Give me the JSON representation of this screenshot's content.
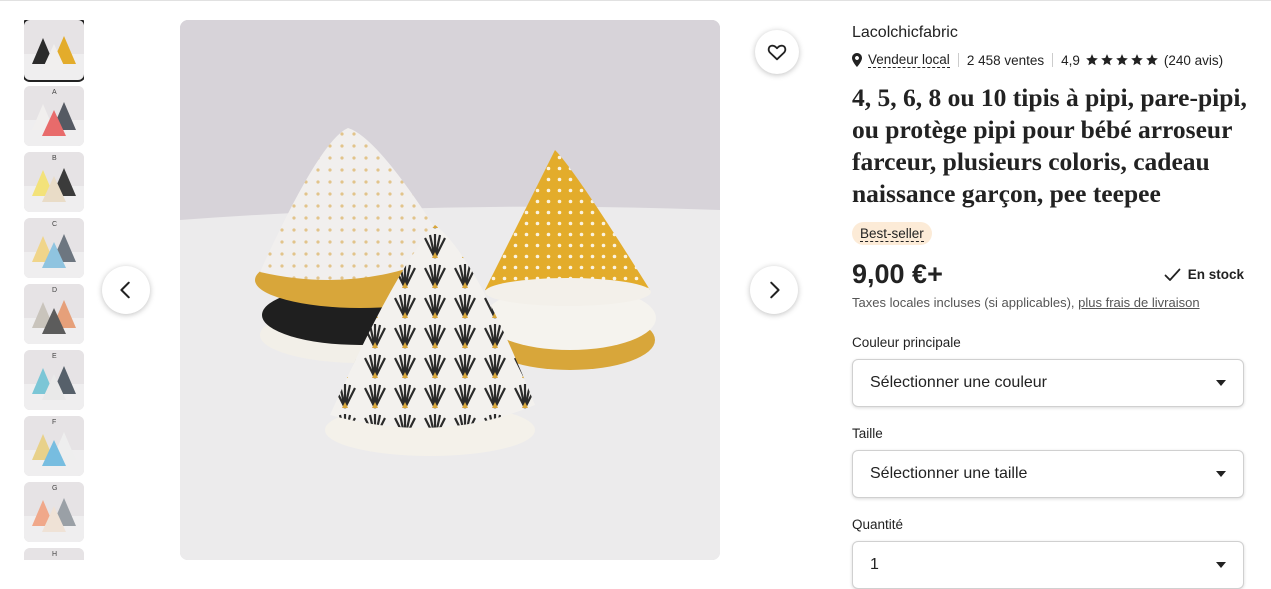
{
  "gallery": {
    "thumbnails": [
      {
        "label": "",
        "selected": true
      },
      {
        "label": "A",
        "selected": false
      },
      {
        "label": "B",
        "selected": false
      },
      {
        "label": "C",
        "selected": false
      },
      {
        "label": "D",
        "selected": false
      },
      {
        "label": "E",
        "selected": false
      },
      {
        "label": "F",
        "selected": false
      },
      {
        "label": "G",
        "selected": false
      },
      {
        "label": "H",
        "selected": false
      }
    ],
    "prev_icon": "chevron-left-icon",
    "next_icon": "chevron-right-icon",
    "favorite_icon": "heart-icon"
  },
  "listing": {
    "shop_name": "Lacolchicfabric",
    "local_seller": "Vendeur local",
    "sales": "2 458 ventes",
    "rating": "4,9",
    "rating_stars": 5,
    "reviews": "(240 avis)",
    "title": "4, 5, 6, 8 ou 10 tipis à pipi, pare-pipi, ou protège pipi pour bébé arroseur farceur, plusieurs coloris, cadeau naissance garçon, pee teepee",
    "badge": "Best-seller",
    "price": "9,00 €+",
    "stock": "En stock",
    "tax_text": "Taxes locales incluses (si applicables), ",
    "shipping_link": "plus frais de livraison"
  },
  "options": {
    "color_label": "Couleur principale",
    "color_value": "Sélectionner une couleur",
    "size_label": "Taille",
    "size_value": "Sélectionner une taille",
    "quantity_label": "Quantité",
    "quantity_value": "1"
  },
  "colors": {
    "badge_bg": "#fcebd7",
    "mustard": "#e3ac2b",
    "text": "#222222"
  }
}
